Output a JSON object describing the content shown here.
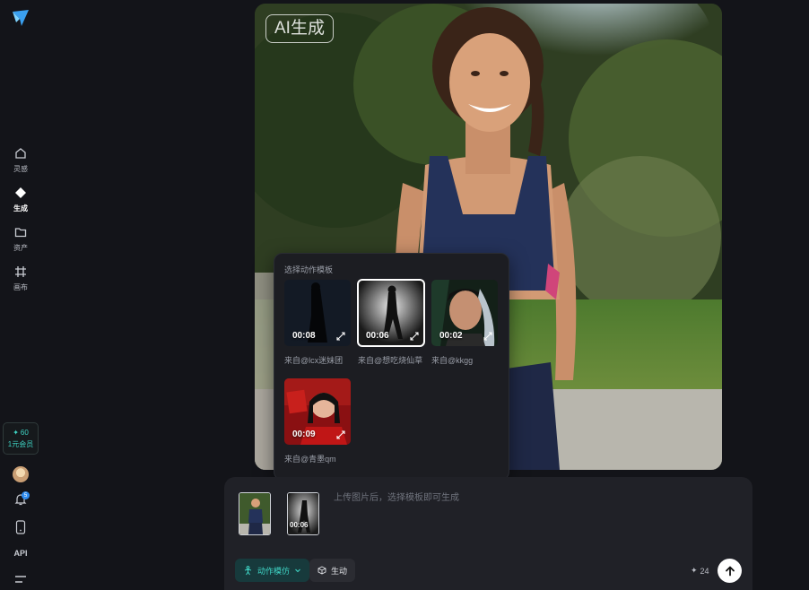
{
  "sidebar": {
    "items": [
      {
        "label": "灵感",
        "icon": "home-icon"
      },
      {
        "label": "生成",
        "icon": "diamond-icon"
      },
      {
        "label": "资产",
        "icon": "folder-icon"
      },
      {
        "label": "画布",
        "icon": "canvas-icon"
      }
    ],
    "credits": {
      "amount": "60",
      "membership": "1元会员"
    },
    "notification_count": "5",
    "api_label": "API"
  },
  "hero": {
    "badge": "AI生成"
  },
  "template_popup": {
    "title": "选择动作模板",
    "templates": [
      {
        "duration": "00:08",
        "source": "来自@lcx迷妹团",
        "selected": false
      },
      {
        "duration": "00:06",
        "source": "来自@想吃烧仙草",
        "selected": true
      },
      {
        "duration": "00:02",
        "source": "来自@kkgg",
        "selected": false
      },
      {
        "duration": "00:09",
        "source": "来自@青墨qm",
        "selected": false
      }
    ]
  },
  "composer": {
    "thumb_duration": "00:06",
    "hint": "上传图片后，选择模板即可生成",
    "mode_label": "动作模仿",
    "effect_label": "生动",
    "cost": "24"
  },
  "colors": {
    "accent": "#3fd6c6",
    "background": "#131419",
    "panel": "#1c1d22"
  }
}
